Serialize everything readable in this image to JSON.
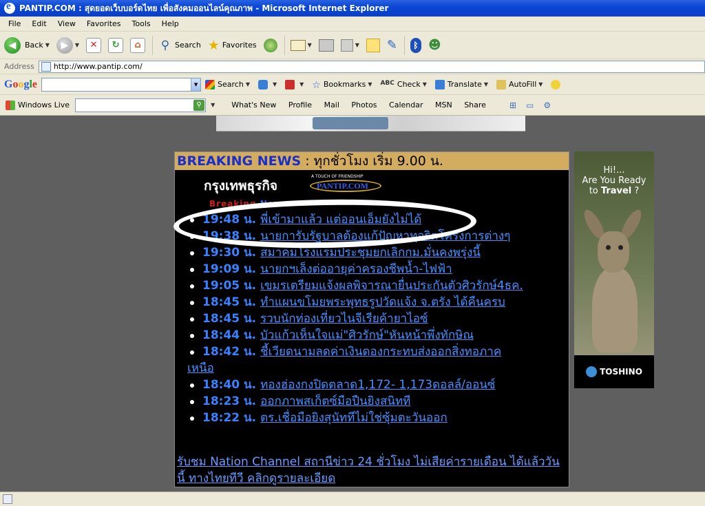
{
  "window": {
    "title": "PANTIP.COM : สุดยอดเว็บบอร์ดไทย เพื่อสังคมออนไลน์คุณภาพ - Microsoft Internet Explorer"
  },
  "menu": [
    "File",
    "Edit",
    "View",
    "Favorites",
    "Tools",
    "Help"
  ],
  "toolbar": {
    "back_label": "Back",
    "search_label": "Search",
    "favorites_label": "Favorites"
  },
  "address": {
    "label": "Address",
    "url": "http://www.pantip.com/"
  },
  "google_bar": {
    "logo": [
      "G",
      "o",
      "o",
      "g",
      "l",
      "e"
    ],
    "search_label": "Search",
    "bookmarks_label": "Bookmarks",
    "check_label": "Check",
    "translate_label": "Translate",
    "autofill_label": "AutoFill"
  },
  "live_bar": {
    "brand": "Windows Live",
    "links": [
      "What's New",
      "Profile",
      "Mail",
      "Photos",
      "Calendar",
      "MSN",
      "Share"
    ]
  },
  "news": {
    "header_bold": "BREAKING NEWS",
    "header_rest": ": ทุกชั่วโมง เริ่ม 9.00 น.",
    "source": "กรุงเทพธุรกิจ",
    "pantip_tagline": "A TOUCH OF FRIENDSHIP",
    "pantip_word": "PANTIP.COM",
    "strip_red": "Breaking",
    "strip_blue": "News",
    "items": [
      {
        "time": "19:48 น.",
        "headline": "พี่เข้ามาแล้ว แต่ออนเอ็มยังไม่ได้"
      },
      {
        "time": "19:38 น.",
        "headline": "นายการับรัฐบาลต้องแก้ปัญหาทุจริตโครงการต่างๆ"
      },
      {
        "time": "19:30 น.",
        "headline": "สมาคมโรงแรมประชุมยกเลิกกม.มั่นคงพรุ่งนี้"
      },
      {
        "time": "19:09 น.",
        "headline": "นายกฯเล็งต่ออายุค่าครองชีพน้ำ-ไฟฟ้า"
      },
      {
        "time": "19:05 น.",
        "headline": "เขมรเตรียมแจ้งผลพิจารณายื่นประกันตัวศิวรักษ์4ธค."
      },
      {
        "time": "18:45 น.",
        "headline": "ทำแผนขโมยพระพุทธรูปวัดแจ้ง จ.ตรัง ได้คืนครบ"
      },
      {
        "time": "18:45 น.",
        "headline": "รวบนักท่องเที่ยวไนจีเรียค้ายาไอซ์"
      },
      {
        "time": "18:44 น.",
        "headline": "บัวแก้วเห็นใจแม่\"ศิวรักษ์\"หันหน้าพึ่งทักษิณ"
      },
      {
        "time": "18:42 น.",
        "headline": "ชี้เวียดนามลดค่าเงินดองกระทบส่งออกสิ่งทอภาค",
        "cont": "เหนือ"
      },
      {
        "time": "18:40 น.",
        "headline": "ทองฮ่องกงปิดตลาด1,172- 1,173ดอลล์/ออนซ์"
      },
      {
        "time": "18:23 น.",
        "headline": "ออกภาพสเก็ตซ์มือปืนยิงสนิทที"
      },
      {
        "time": "18:22 น.",
        "headline": "ตร.เชื่อมือยิงสุนัททีไม่ใช่ซุ้มตะวันออก"
      }
    ],
    "nation_link": "รับชม Nation Channel สถานีข่าว 24 ชั่วโมง ไม่เสียค่ารายเดือน ได้แล้ววันนี้ ทางไทยทีวี คลิกดูรายละเอียด"
  },
  "ad": {
    "line1": "Hi!...",
    "line2": "Are You Ready",
    "line3_pre": "to",
    "line3_bold": "Travel",
    "line3_post": "?",
    "brand": "TOSHINO"
  },
  "colors": {
    "breaking_blue": "#1a2fc7",
    "header_gold": "#d3ac60",
    "link_blue": "#4a8fff"
  }
}
